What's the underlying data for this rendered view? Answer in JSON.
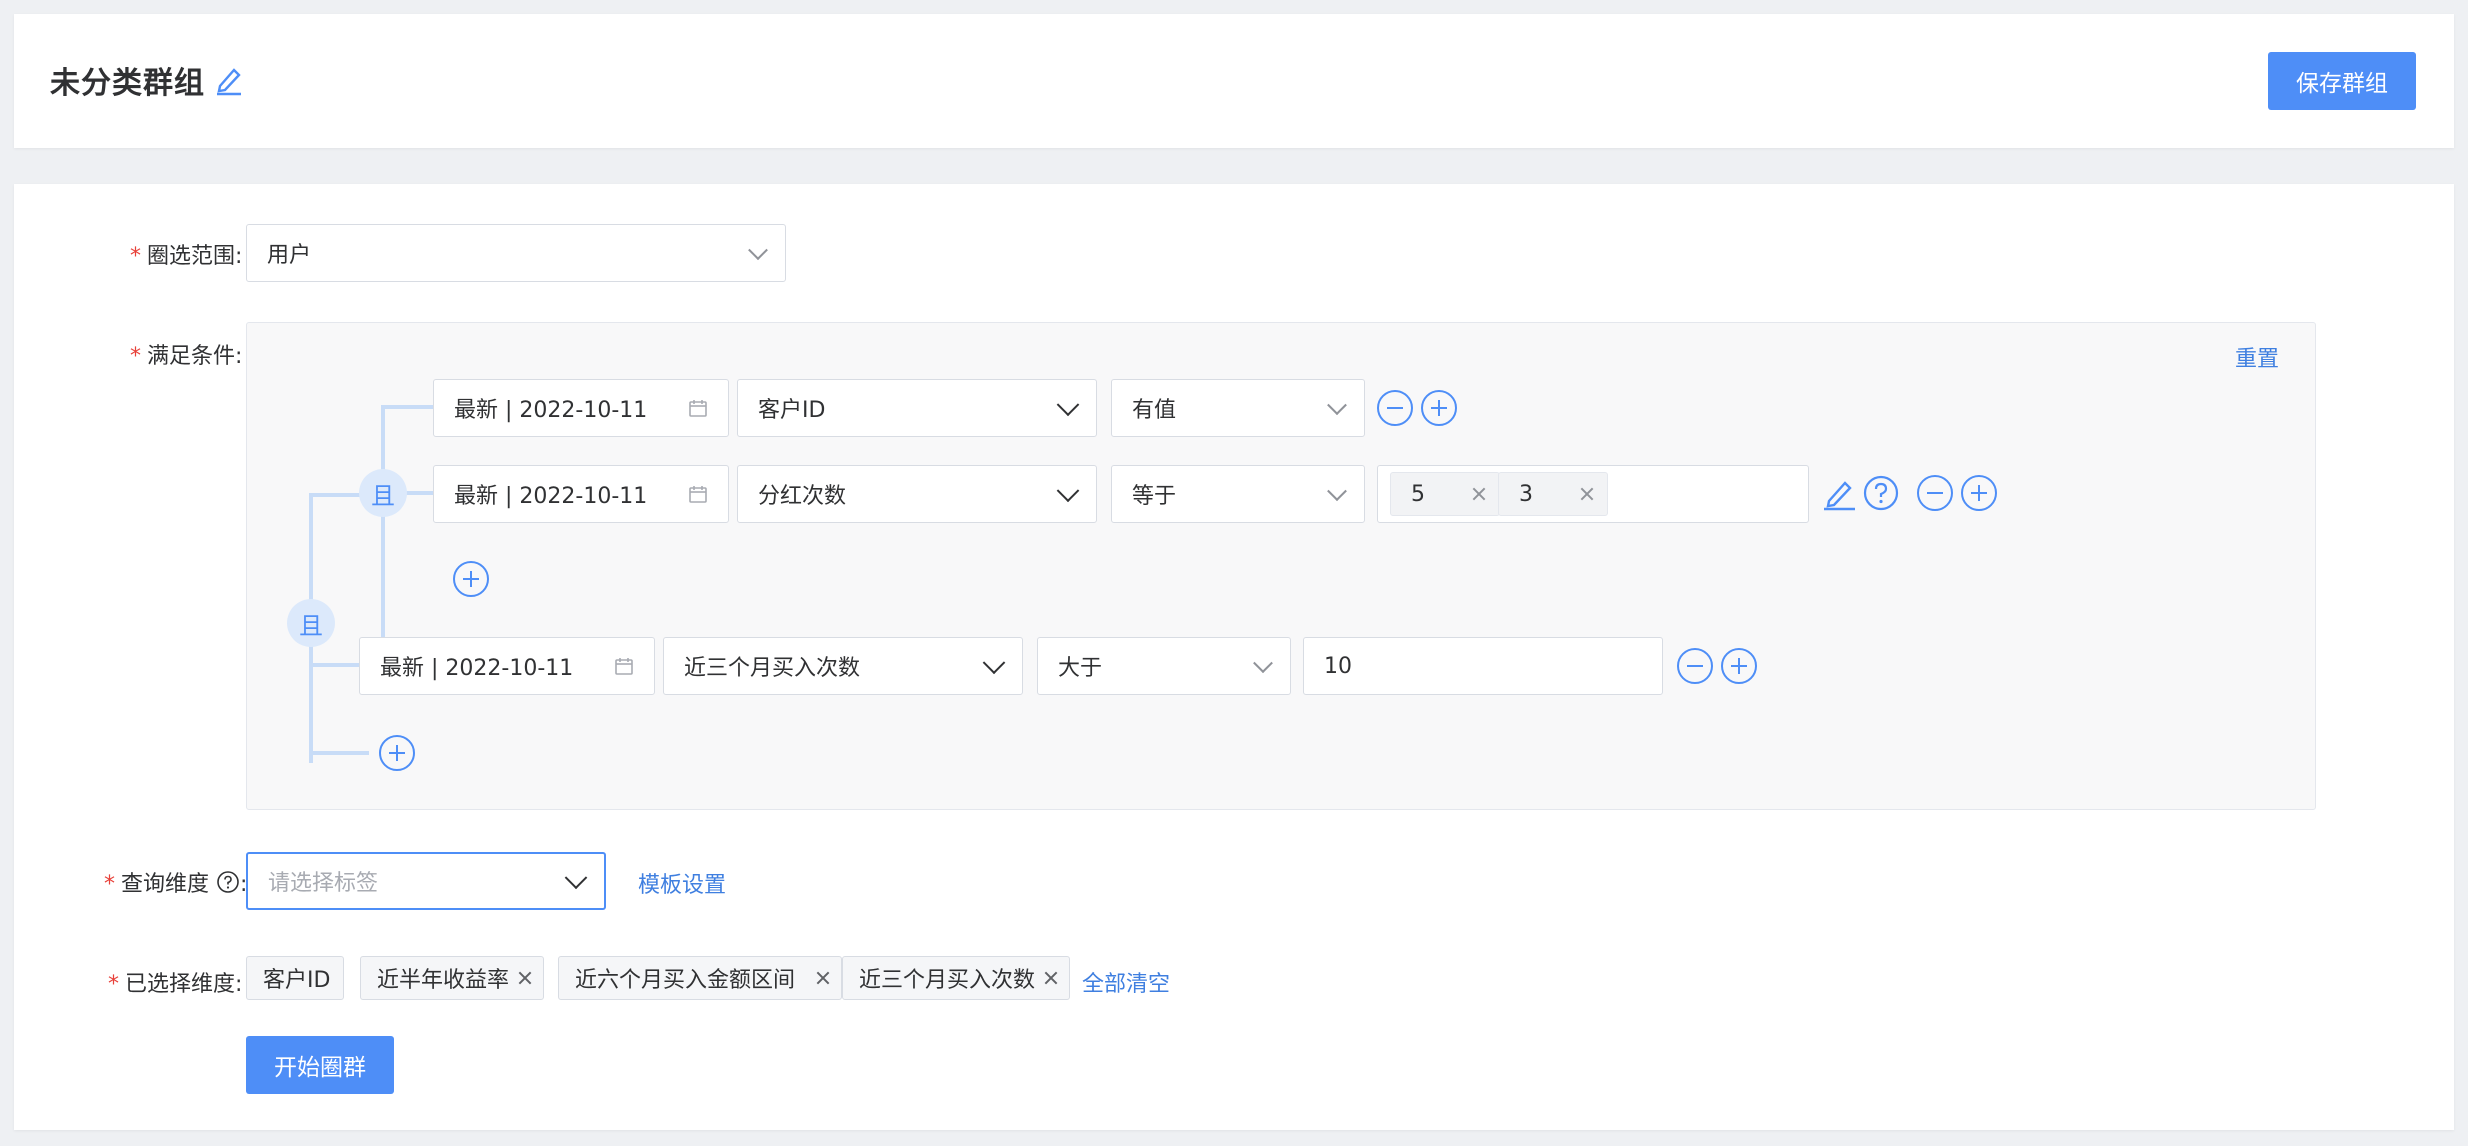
{
  "header": {
    "title": "未分类群组",
    "save_label": "保存群组"
  },
  "form": {
    "scope": {
      "label": "圈选范围",
      "value": "用户"
    },
    "conditions": {
      "label": "满足条件",
      "reset_label": "重置",
      "group_operator": "且",
      "inner_group": {
        "operator": "且",
        "rows": [
          {
            "date": "最新 | 2022-10-11",
            "field": "客户ID",
            "op": "有值"
          },
          {
            "date": "最新 | 2022-10-11",
            "field": "分红次数",
            "op": "等于",
            "values": [
              "5",
              "3"
            ]
          }
        ]
      },
      "outer_row": {
        "date": "最新 | 2022-10-11",
        "field": "近三个月买入次数",
        "op": "大于",
        "value": "10"
      }
    },
    "dimension": {
      "label": "查询维度",
      "placeholder": "请选择标签",
      "template_link": "模板设置"
    },
    "selected": {
      "label": "已选择维度",
      "chips": [
        "客户ID",
        "近半年收益率",
        "近六个月买入金额区间",
        "近三个月买入次数"
      ],
      "clear_label": "全部清空"
    },
    "start_label": "开始圈群"
  },
  "colors": {
    "primary": "#4e8ef7",
    "link": "#3f7fe0",
    "required": "#e8413a"
  }
}
